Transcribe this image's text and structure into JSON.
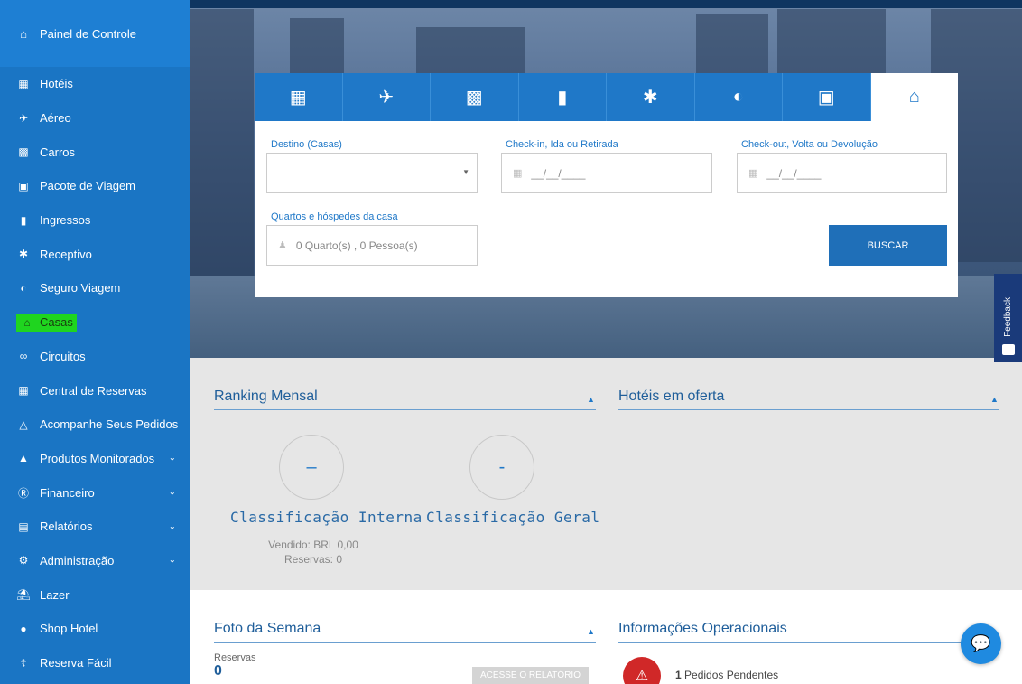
{
  "sidebar": {
    "top": {
      "label": "Painel de Controle",
      "icon": "home-icon"
    },
    "items": [
      {
        "label": "Hotéis",
        "icon": "hotel-icon"
      },
      {
        "label": "Aéreo",
        "icon": "plane-icon"
      },
      {
        "label": "Carros",
        "icon": "car-icon"
      },
      {
        "label": "Pacote de Viagem",
        "icon": "suitcase-icon"
      },
      {
        "label": "Ingressos",
        "icon": "ticket-icon"
      },
      {
        "label": "Receptivo",
        "icon": "receptive-icon"
      },
      {
        "label": "Seguro Viagem",
        "icon": "shield-icon"
      },
      {
        "label": "Casas",
        "icon": "house-icon"
      },
      {
        "label": "Circuitos",
        "icon": "circuit-icon"
      },
      {
        "label": "Central de Reservas",
        "icon": "calendar-icon"
      },
      {
        "label": "Acompanhe Seus Pedidos",
        "icon": "bag-icon"
      },
      {
        "label": "Produtos Monitorados",
        "icon": "bell-icon"
      },
      {
        "label": "Financeiro",
        "icon": "money-icon"
      },
      {
        "label": "Relatórios",
        "icon": "report-icon"
      },
      {
        "label": "Administração",
        "icon": "gear-icon"
      },
      {
        "label": "Lazer",
        "icon": "leisure-icon"
      },
      {
        "label": "Shop Hotel",
        "icon": "shop-icon"
      },
      {
        "label": "Reserva Fácil",
        "icon": "easy-booking-icon"
      }
    ]
  },
  "widget": {
    "tabs": [
      "hotel-tab-icon",
      "plane-tab-icon",
      "car-tab-icon",
      "ticket-tab-icon",
      "receptive-tab-icon",
      "insurance-tab-icon",
      "package-tab-icon",
      "house-tab-icon"
    ],
    "destino_label": "Destino (Casas)",
    "checkin_label": "Check-in, Ida ou Retirada",
    "checkin_placeholder": "__/__/____",
    "checkout_label": "Check-out, Volta ou Devolução",
    "checkout_placeholder": "__/__/____",
    "quartos_label": "Quartos e hóspedes da casa",
    "quartos_value": "0 Quarto(s) , 0 Pessoa(s)",
    "buscar": "BUSCAR"
  },
  "feedback": "Feedback",
  "ranking": {
    "title": "Ranking Mensal",
    "interna_value": "–",
    "geral_value": "-",
    "interna_label": "Classificação Interna",
    "geral_label": "Classificação Geral",
    "vendido": "Vendido: BRL 0,00",
    "reservas": "Reservas: 0"
  },
  "hoteis_oferta": {
    "title": "Hotéis em oferta"
  },
  "foto_semana": {
    "title": "Foto da Semana",
    "reservas_label": "Reservas",
    "reservas_value": "0",
    "button": "ACESSE O RELATÓRIO"
  },
  "info_operacionais": {
    "title": "Informações Operacionais",
    "pendentes_count": "1",
    "pendentes_label": "Pedidos Pendentes"
  },
  "colors": {
    "sidebar": "#1a75c4",
    "accent": "#1f78c8",
    "highlight": "#1fd51f",
    "alert": "#d02828"
  }
}
